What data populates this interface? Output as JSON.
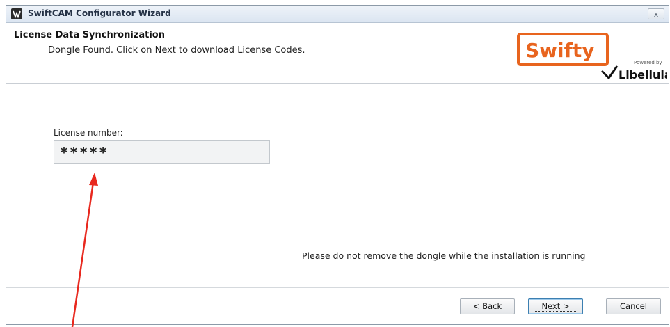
{
  "window": {
    "title": "SwiftCAM Configurator Wizard",
    "close_label": "x"
  },
  "header": {
    "title": "License Data Synchronization",
    "subtitle": "Dongle Found. Click on Next to download License Codes.",
    "logo": {
      "brand_text": "Swifty",
      "powered_by": "Powered by",
      "company_text": "Libellula",
      "brand_color": "#e8641e"
    }
  },
  "form": {
    "license_label": "License number:",
    "license_value": "*****"
  },
  "notice": "Please do not remove the dongle while the installation is running",
  "buttons": {
    "back": "< Back",
    "next": "Next >",
    "cancel": "Cancel"
  },
  "annotation": {
    "arrow_color": "#e8281e"
  }
}
